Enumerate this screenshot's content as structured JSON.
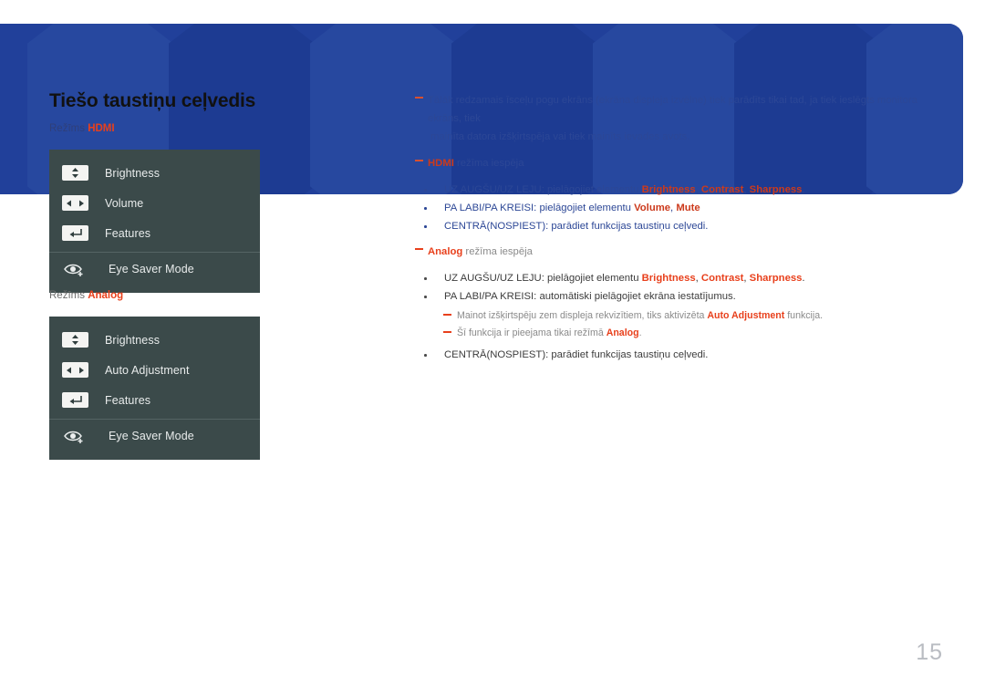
{
  "page": {
    "number": "15",
    "title": "Tiešo taustiņu ceļvedis",
    "accent_color": "#e8401c",
    "banner_color": "#21409a",
    "osd_bg_color": "#3b4a4a"
  },
  "modes": {
    "hdmi": {
      "prefix": "Režīms",
      "value": "HDMI"
    },
    "analog": {
      "prefix": "Režīms",
      "value": "Analog"
    }
  },
  "osd_menus": [
    {
      "name": "hdmi-osd",
      "items": [
        {
          "icon": "up-down-key-icon",
          "label": "Brightness"
        },
        {
          "icon": "left-right-key-icon",
          "label": "Volume"
        },
        {
          "icon": "enter-key-icon",
          "label": "Features"
        },
        {
          "icon": "eye-saver-icon",
          "label": "Eye Saver Mode"
        }
      ]
    },
    {
      "name": "analog-osd",
      "items": [
        {
          "icon": "up-down-key-icon",
          "label": "Brightness"
        },
        {
          "icon": "left-right-key-icon",
          "label": "Auto Adjustment"
        },
        {
          "icon": "enter-key-icon",
          "label": "Features"
        },
        {
          "icon": "eye-saver-icon",
          "label": "Eye Saver Mode"
        }
      ]
    }
  ],
  "notes": {
    "intro_line1": "Tālāk redzamais īsceļu pogu ekrāns (ekrāna displeja izvēlne) tiek parādīts tikai tad, ja tiek ieslēgts monitora ekrāns, tiek",
    "intro_line2": "mainīta datora izšķirtspēja vai tiek mainīts ievades avots.",
    "hdmi_heading_bold": "HDMI",
    "hdmi_heading_rest": " režīma iespēja",
    "hdmi_bullets": [
      {
        "pre": "UZ AUGŠU/UZ LEJU: pielāgojiet elementu ",
        "bold1": "Brightness",
        "mid1": ", ",
        "bold2": "Contrast",
        "mid2": ", ",
        "bold3": "Sharpness",
        "post": "."
      },
      {
        "pre": "PA LABI/PA KREISI: pielāgojiet elementu ",
        "bold1": "Volume",
        "mid1": ", ",
        "bold2": "Mute",
        "post": ""
      },
      {
        "pre": "CENTRĀ(NOSPIEST): parādiet funkcijas taustiņu ceļvedi.",
        "post": ""
      }
    ],
    "analog_heading_bold": "Analog",
    "analog_heading_rest": " režīma iespēja",
    "analog_bullet1": {
      "pre": "UZ AUGŠU/UZ LEJU: pielāgojiet elementu ",
      "bold1": "Brightness",
      "mid1": ", ",
      "bold2": "Contrast",
      "mid2": ", ",
      "bold3": "Sharpness",
      "post": "."
    },
    "analog_bullet2": "PA LABI/PA KREISI: automātiski pielāgojiet ekrāna iestatījumus.",
    "analog_sub1": {
      "pre": "Mainot izšķirtspēju zem displeja rekvizītiem, tiks aktivizēta ",
      "bold": "Auto Adjustment",
      "post": " funkcija."
    },
    "analog_sub2": {
      "pre": "Šī funkcija ir pieejama tikai režīmā ",
      "bold": "Analog",
      "post": "."
    },
    "analog_bullet3": "CENTRĀ(NOSPIEST): parādiet funkcijas taustiņu ceļvedi."
  }
}
